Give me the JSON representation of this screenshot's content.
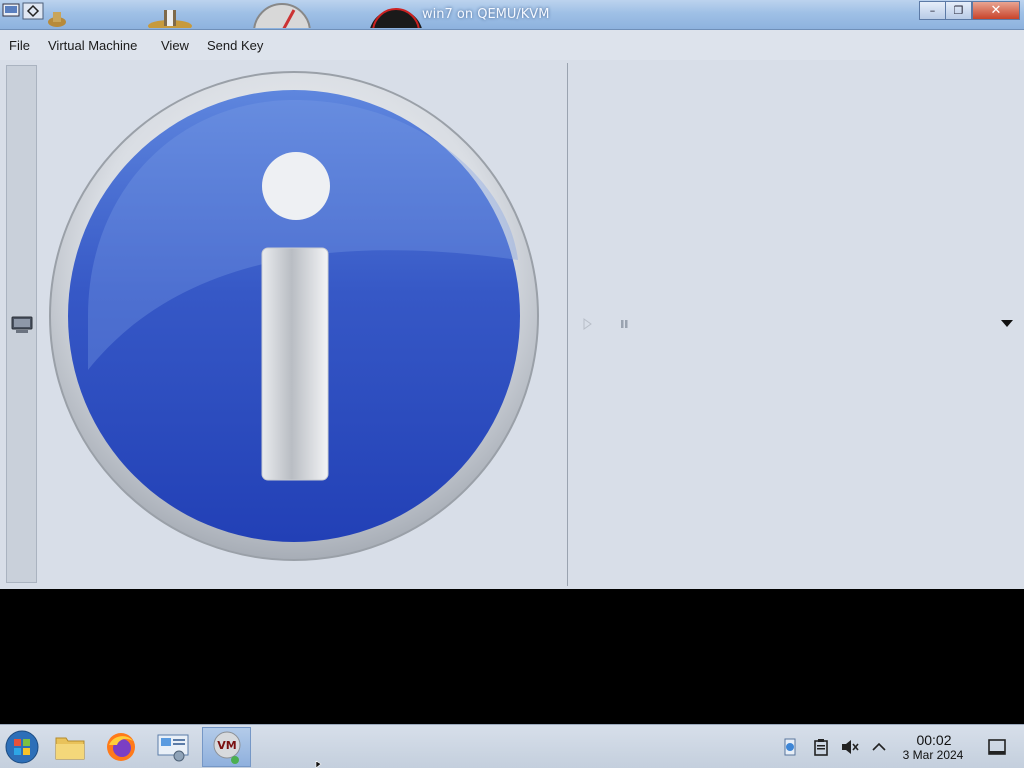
{
  "window": {
    "title": "win7 on QEMU/KVM",
    "minimize_glyph": "–",
    "maximize_glyph": "❐",
    "close_glyph": "✕"
  },
  "menu": {
    "items": [
      "File",
      "Virtual Machine",
      "View",
      "Send Key"
    ]
  },
  "info_dialog": {
    "icon": "info-icon"
  },
  "playback": {
    "play_icon": "play-icon",
    "pause_icon": "pause-icon",
    "dropdown_icon": "chevron-down-icon"
  },
  "taskbar": {
    "apps": [
      {
        "name": "start-orb-icon"
      },
      {
        "name": "file-manager-icon"
      },
      {
        "name": "firefox-icon"
      },
      {
        "name": "control-panel-icon"
      },
      {
        "name": "virt-manager-icon"
      }
    ],
    "tray": {
      "icons": [
        "updates-icon",
        "clipboard-icon",
        "volume-muted-icon",
        "chevron-up-icon"
      ],
      "time": "00:02",
      "date": "3 Mar 2024"
    }
  },
  "colors": {
    "info_blue": "#2f4fc0",
    "titlebar": "#9fc0e6",
    "close_red": "#c8432a"
  }
}
